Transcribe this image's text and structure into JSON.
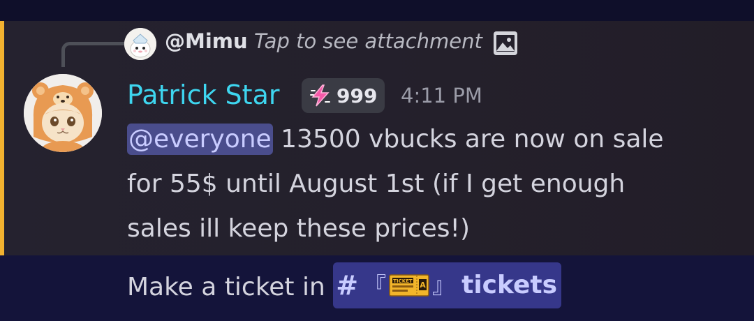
{
  "reply": {
    "author": "@Mimu",
    "text": "Tap to see attachment",
    "attachment_icon": "image-icon"
  },
  "message": {
    "author": "Patrick Star",
    "author_color": "#3ed6f0",
    "badge_icon": "lightning-icon",
    "badge_count": "999",
    "timestamp": "4:11 PM",
    "mention": "@everyone",
    "lines": [
      " 13500 vbucks are now on sale",
      "for 55$ until August 1st (if I get enough",
      "sales ill keep these prices!)"
    ],
    "footer_text": "Make a ticket in ",
    "channel": {
      "hash": "#",
      "bracket_open": "『",
      "emoji": "ticket-emoji",
      "bracket_close": "』",
      "name": "tickets"
    }
  },
  "colors": {
    "mention_bar": "#f2b230",
    "mention_bg": "#4a4d8c",
    "channel_bg": "#36378a"
  }
}
